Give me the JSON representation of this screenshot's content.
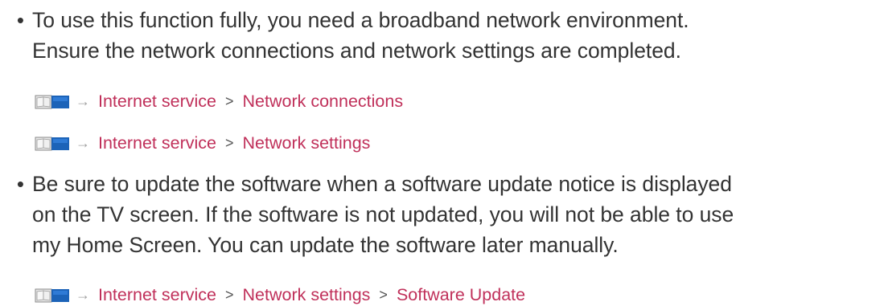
{
  "bullets": [
    {
      "text": "To use this function fully, you need a broadband network environment.\nEnsure the network connections and network settings are completed."
    },
    {
      "text": "Be sure to update the software when a software update notice is displayed\non the TV screen. If the software is not updated, you will not be able to use\nmy Home Screen. You can update the software later manually."
    }
  ],
  "bullet_glyph": "•",
  "arrow_glyph": "→",
  "separator_glyph": ">",
  "links": {
    "row1": [
      "Internet service",
      "Network connections"
    ],
    "row2": [
      "Internet service",
      "Network settings"
    ],
    "row3": [
      "Internet service",
      "Network settings",
      "Software Update"
    ]
  },
  "colors": {
    "link": "#c0305a",
    "text": "#333333",
    "icon_blue": "#1c63b8"
  },
  "icons": {
    "eHelp": "book-icon"
  }
}
